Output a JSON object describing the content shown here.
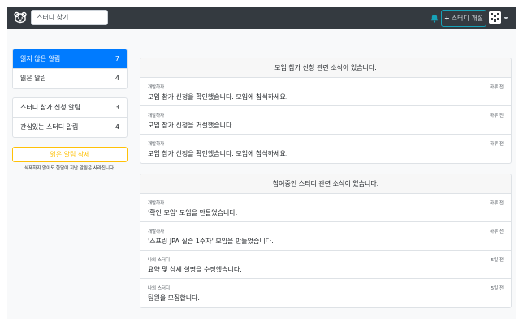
{
  "navbar": {
    "search_placeholder": "스터디 찾기",
    "open_study_label": "스터디 개설",
    "open_study_plus": "+"
  },
  "sidebar": {
    "read_status": [
      {
        "label": "읽지 않은 알림",
        "count": "7"
      },
      {
        "label": "읽은 알림",
        "count": "4"
      }
    ],
    "categories": [
      {
        "label": "스터디 참가 신청 알림",
        "count": "3"
      },
      {
        "label": "관심있는 스터디 알림",
        "count": "4"
      }
    ],
    "delete_button": "읽은 알림 삭제",
    "delete_note": "삭제하지 않아도 한달이 지난 알림은 사라집니다."
  },
  "cards": [
    {
      "header": "모임 참가 신청 관련 소식이 있습니다.",
      "rows": [
        {
          "author": "개발하자",
          "time": "하루 전",
          "message": "모임 참가 신청을 확인했습니다. 모임에 참석하세요."
        },
        {
          "author": "개발하자",
          "time": "하루 전",
          "message": "모임 참가 신청을 거절했습니다."
        },
        {
          "author": "개발하자",
          "time": "하루 전",
          "message": "모임 참가 신청을 확인했습니다. 모임에 참석하세요."
        }
      ]
    },
    {
      "header": "참여중인 스터디 관련 소식이 있습니다.",
      "rows": [
        {
          "author": "개발하자",
          "time": "하루 전",
          "message": "'확인 모임' 모임을 만들었습니다."
        },
        {
          "author": "개발하자",
          "time": "하루 전",
          "message": "'스프링 JPA 실습 1주차' 모임을 만들었습니다."
        },
        {
          "author": "나의 스터디",
          "time": "5일 전",
          "message": "요약 및 상세 설명을 수정했습니다."
        },
        {
          "author": "나의 스터디",
          "time": "5일 전",
          "message": "팀원을 모집합니다."
        }
      ]
    }
  ],
  "colors": {
    "navbar_bg": "#343a40",
    "active": "#007bff",
    "warning": "#ffc107",
    "info": "#17a2b8"
  },
  "icons": {
    "logo": "bear-logo-icon",
    "bell": "bell-icon",
    "avatar": "identicon-avatar",
    "caret": "caret-down-icon"
  }
}
